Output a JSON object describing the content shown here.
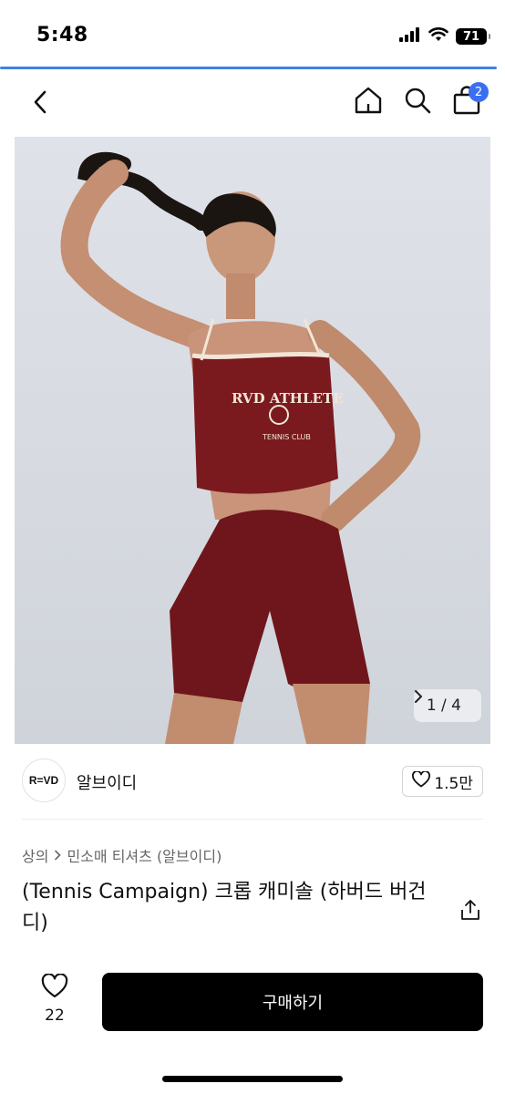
{
  "status_bar": {
    "time": "5:48",
    "battery": "71",
    "icons": [
      "signal-icon",
      "wifi-icon",
      "battery-icon"
    ]
  },
  "nav": {
    "icons": [
      "back-chevron-icon",
      "home-icon",
      "search-icon",
      "shopping-bag-icon"
    ],
    "cart_count": "2"
  },
  "gallery": {
    "current": "1",
    "separator": "/",
    "total": "4",
    "indicator": "1 / 4",
    "text_on_garment_top": "RVD ATHLETE",
    "text_on_garment_sub": "TENNIS CLUB",
    "garment_color": "#7a1a1f"
  },
  "seller": {
    "logo_text": "R=VD",
    "name": "알브이디",
    "likes": "1.5만"
  },
  "product": {
    "breadcrumb": [
      "상의",
      "민소매 티셔츠 (알브이디)"
    ],
    "title": "(Tennis Campaign) 크롭 캐미솔 (하버드 버건디)"
  },
  "bottom_bar": {
    "wish_count": "22",
    "buy_label": "구매하기"
  },
  "colors": {
    "accent": "#3a6ff2",
    "progress": "#3c82e6",
    "buy_button": "#000000"
  }
}
